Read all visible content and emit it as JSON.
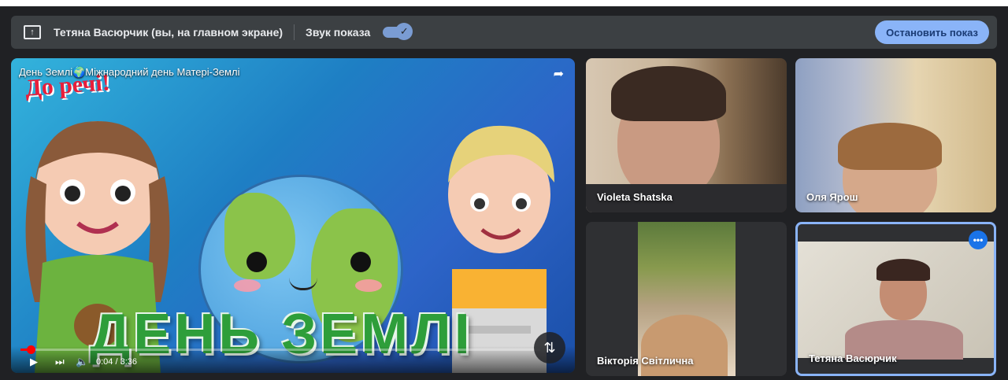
{
  "presenter_bar": {
    "presenter_label": "Тетяна Васюрчик (вы, на главном экране)",
    "sound_label": "Звук показа",
    "sound_enabled": true,
    "stop_button": "Остановить показ"
  },
  "main_video": {
    "title": "День Землі🌍Міжнародний день Матері-Землі",
    "sticker_text": "До речі!",
    "overlay_text": "ДЕНЬ ЗЕМЛІ",
    "time": "0:04 / 3:36",
    "progress": 0.02
  },
  "participants": [
    {
      "name": "Violeta Shatska"
    },
    {
      "name": "Оля Ярош"
    },
    {
      "name": "Вікторія Світлична"
    },
    {
      "name": "Тетяна Васюрчик",
      "active": true
    }
  ],
  "colors": {
    "accent": "#8ab4f8",
    "bar_bg": "#3c4043",
    "page_bg": "#202124",
    "progress": "#ff0000"
  },
  "icons": [
    "present-screen-icon",
    "check-icon",
    "share-icon",
    "play-icon",
    "next-icon",
    "volume-icon",
    "swap-icon",
    "more-icon"
  ]
}
